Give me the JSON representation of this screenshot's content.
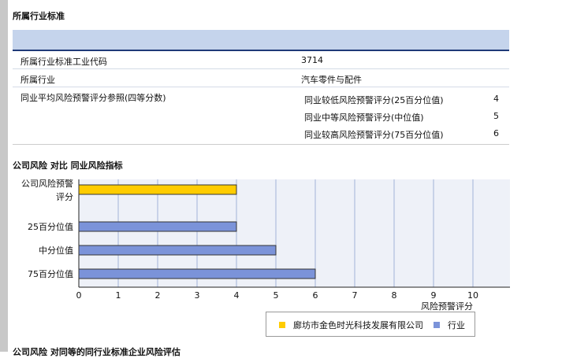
{
  "section1": {
    "title": "所属行业标准"
  },
  "table": {
    "rows": [
      {
        "label": "所属行业标准工业代码",
        "value": "3714"
      },
      {
        "label": "所属行业",
        "value": "汽车零件与配件"
      },
      {
        "label": "同业平均风险预警评分参照(四等分数)"
      }
    ],
    "sub_rows": [
      {
        "label": "同业较低风险预警评分(25百分位值)",
        "value": "4"
      },
      {
        "label": "同业中等风险预警评分(中位值)",
        "value": "5"
      },
      {
        "label": "同业较高风险预警评分(75百分位值)",
        "value": "6"
      }
    ]
  },
  "section2": {
    "title": "公司风险 对比 同业风险指标"
  },
  "chart_data": {
    "type": "bar",
    "orientation": "horizontal",
    "categories": [
      "公司风险预警评分",
      "25百分位值",
      "中分位值",
      "75百分位值"
    ],
    "category_lines": [
      [
        "公司风险预警",
        "评分"
      ],
      [
        "25百分位值"
      ],
      [
        "中分位值"
      ],
      [
        "75百分位值"
      ]
    ],
    "series": [
      {
        "name": "廊坊市金色时光科技发展有限公司",
        "values": [
          4,
          null,
          null,
          null
        ],
        "color": "#ffcc00"
      },
      {
        "name": "行业",
        "values": [
          null,
          4,
          5,
          6
        ],
        "color": "#7b93d9"
      }
    ],
    "xlabel": "风险预警评分",
    "xlim": [
      0,
      10
    ],
    "xticks": [
      0,
      1,
      2,
      3,
      4,
      5,
      6,
      7,
      8,
      9,
      10
    ],
    "grid": true,
    "legend_position": "bottom-right"
  },
  "bottom": {
    "text": "公司风险 对同等的同行业标准企业风险评估"
  }
}
